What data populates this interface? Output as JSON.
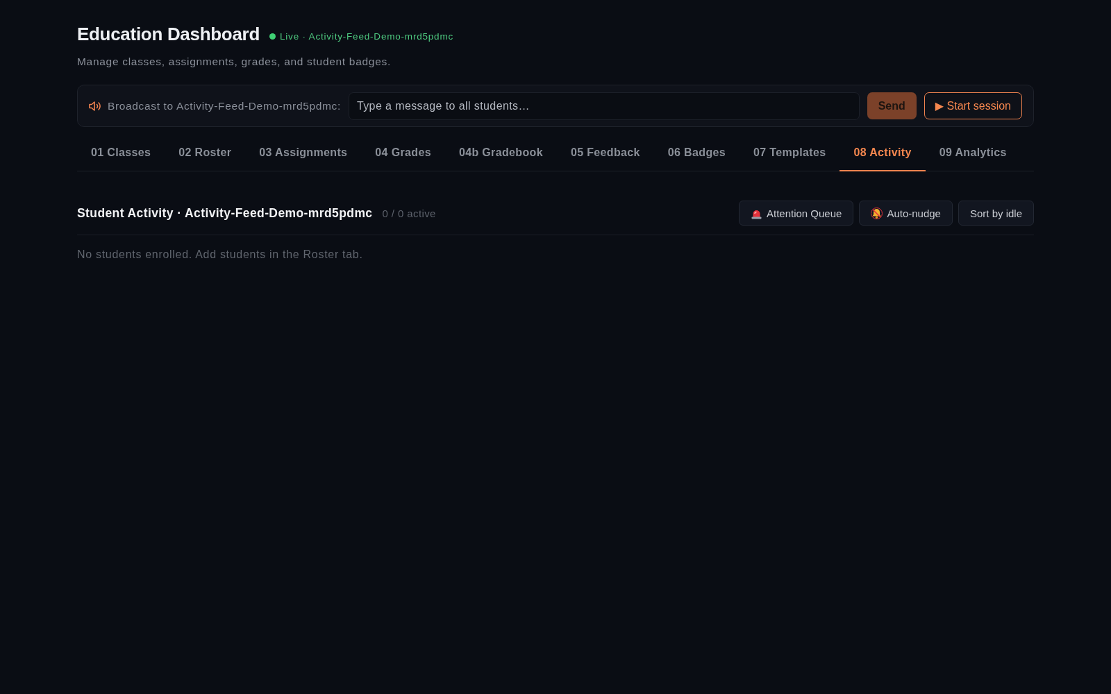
{
  "header": {
    "title": "Education Dashboard",
    "status": "Live · Activity-Feed-Demo-mrd5pdmc",
    "subtitle": "Manage classes, assignments, grades, and student badges."
  },
  "broadcast": {
    "label": "Broadcast to Activity-Feed-Demo-mrd5pdmc:",
    "placeholder": "Type a message to all students…",
    "send": {
      "label": "Send",
      "disabled": true
    },
    "session_button": "▶ Start session"
  },
  "tabs": [
    {
      "label": "01 Classes",
      "selected": false
    },
    {
      "label": "02 Roster",
      "selected": false
    },
    {
      "label": "03 Assignments",
      "selected": false
    },
    {
      "label": "04 Grades",
      "selected": false
    },
    {
      "label": "04b Gradebook",
      "selected": false
    },
    {
      "label": "05 Feedback",
      "selected": false
    },
    {
      "label": "06 Badges",
      "selected": false
    },
    {
      "label": "07 Templates",
      "selected": false
    },
    {
      "label": "08 Activity",
      "selected": true
    },
    {
      "label": "09 Analytics",
      "selected": false
    }
  ],
  "activity": {
    "title": "Student Activity · Activity-Feed-Demo-mrd5pdmc",
    "count": "0 / 0 active",
    "actions": [
      {
        "kind": "alert",
        "label": "Attention Queue"
      },
      {
        "kind": "mute",
        "label": "Auto-nudge"
      },
      {
        "kind": "plain",
        "label": "Sort by idle"
      }
    ],
    "empty_message": "No students enrolled. Add students in the Roster tab."
  }
}
